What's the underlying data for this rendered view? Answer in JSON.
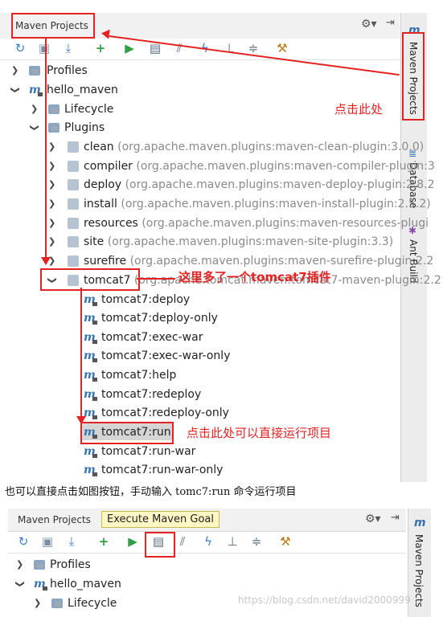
{
  "panel1": {
    "title": "Maven Projects",
    "sidebar_tabs": [
      "Maven Projects",
      "Database",
      "Ant Build"
    ],
    "tree": {
      "profiles": "Profiles",
      "project": "hello_maven",
      "lifecycle": "Lifecycle",
      "plugins_label": "Plugins",
      "plugins": [
        {
          "name": "clean",
          "coord": "(org.apache.maven.plugins:maven-clean-plugin:3.0.0)"
        },
        {
          "name": "compiler",
          "coord": "(org.apache.maven.plugins:maven-compiler-plugin:3"
        },
        {
          "name": "deploy",
          "coord": "(org.apache.maven.plugins:maven-deploy-plugin:2.8.2"
        },
        {
          "name": "install",
          "coord": "(org.apache.maven.plugins:maven-install-plugin:2.5.2)"
        },
        {
          "name": "resources",
          "coord": "(org.apache.maven.plugins:maven-resources-plugi"
        },
        {
          "name": "site",
          "coord": "(org.apache.maven.plugins:maven-site-plugin:3.3)"
        },
        {
          "name": "surefire",
          "coord": "(org.apache.maven.plugins:maven-surefire-plugin:2.2"
        },
        {
          "name": "tomcat7",
          "coord": "(org.apache.tomcat.maven:tomcat7-maven-plugin:2.2"
        }
      ],
      "goals": [
        "tomcat7:deploy",
        "tomcat7:deploy-only",
        "tomcat7:exec-war",
        "tomcat7:exec-war-only",
        "tomcat7:help",
        "tomcat7:redeploy",
        "tomcat7:redeploy-only",
        "tomcat7:run",
        "tomcat7:run-war",
        "tomcat7:run-war-only"
      ]
    },
    "annotations": {
      "click_here": "点击此处",
      "tomcat_added": "这里多了一个tomcat7插件",
      "run_here": "点击此处可以直接运行项目"
    }
  },
  "caption": "也可以直接点击如图按钮，手动输入 tomc7:run 命令运行项目",
  "panel2": {
    "title": "Maven Projects",
    "tooltip": "Execute Maven Goal",
    "sidebar_tab": "Maven Projects",
    "tree": [
      "Profiles",
      "hello_maven",
      "Lifecycle"
    ]
  },
  "watermark": "https://blog.csdn.net/david2000999",
  "colors": {
    "annotation": "#e52222",
    "maven_blue": "#3572b0",
    "run_green": "#2ea043",
    "tooltip_bg": "#fff8c4"
  }
}
